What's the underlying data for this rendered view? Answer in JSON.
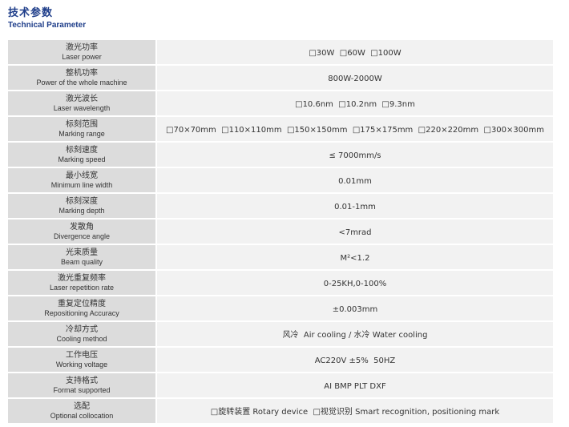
{
  "header": {
    "title_zh": "技术参数",
    "title_en": "Technical Parameter"
  },
  "rows": [
    {
      "label_zh": "激光功率",
      "label_en": "Laser power",
      "value": "□30W  □60W  □100W"
    },
    {
      "label_zh": "整机功率",
      "label_en": "Power of the whole machine",
      "value": "800W-2000W"
    },
    {
      "label_zh": "激光波长",
      "label_en": "Laser wavelength",
      "value": "□10.6nm  □10.2nm  □9.3nm"
    },
    {
      "label_zh": "标刻范围",
      "label_en": "Marking  range",
      "value": "□70×70mm  □110×110mm  □150×150mm  □175×175mm  □220×220mm  □300×300mm"
    },
    {
      "label_zh": "标刻速度",
      "label_en": "Marking  speed",
      "value": "≤ 7000mm/s"
    },
    {
      "label_zh": "最小线宽",
      "label_en": "Minimum line width",
      "value": "0.01mm"
    },
    {
      "label_zh": "标刻深度",
      "label_en": "Marking depth",
      "value": "0.01-1mm"
    },
    {
      "label_zh": "发散角",
      "label_en": "Divergence angle",
      "value": "<7mrad"
    },
    {
      "label_zh": "光束质量",
      "label_en": "Beam quality",
      "value": "M²<1.2"
    },
    {
      "label_zh": "激光重复频率",
      "label_en": "Laser repetition rate",
      "value": "0-25KH,0-100%"
    },
    {
      "label_zh": "重复定位精度",
      "label_en": "Repositioning Accuracy",
      "value": "±0.003mm"
    },
    {
      "label_zh": "冷却方式",
      "label_en": "Cooling method",
      "value": "风冷  Air cooling / 水冷 Water cooling"
    },
    {
      "label_zh": "工作电压",
      "label_en": "Working voltage",
      "value": "AC220V ±5%  50HZ"
    },
    {
      "label_zh": "支持格式",
      "label_en": "Format supported",
      "value": "AI BMP PLT DXF"
    },
    {
      "label_zh": "选配",
      "label_en": "Optional collocation",
      "value": "□旋转装置 Rotary device  □视觉识别 Smart recognition, positioning mark"
    }
  ]
}
